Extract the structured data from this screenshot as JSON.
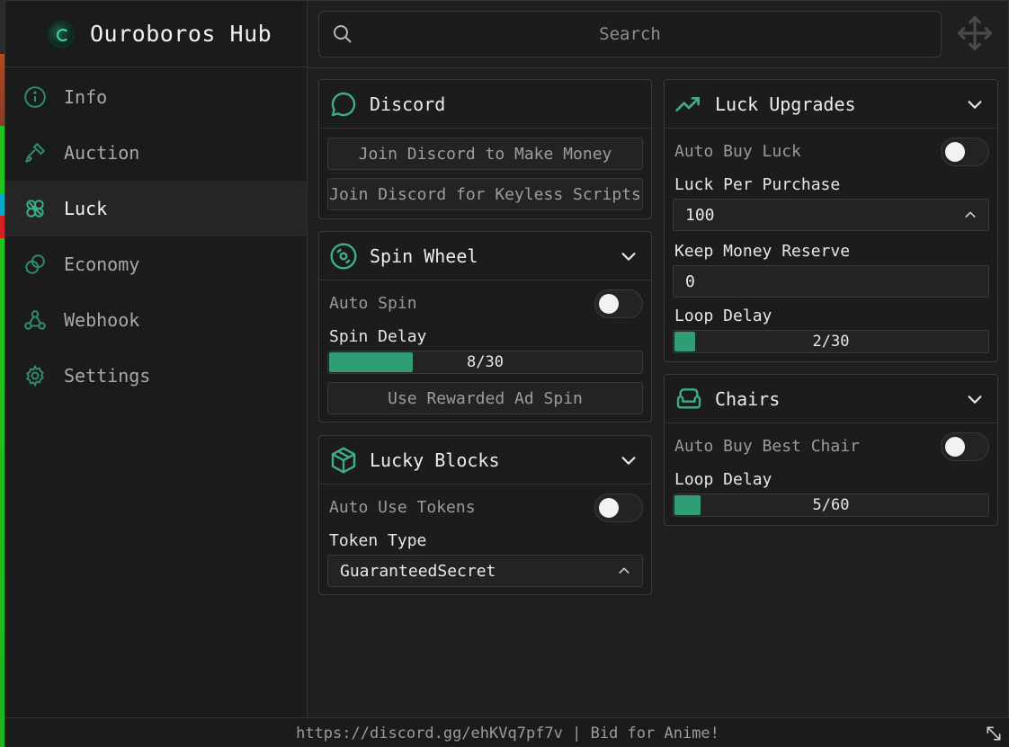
{
  "app": {
    "title": "Ouroboros Hub"
  },
  "search": {
    "placeholder": "Search"
  },
  "sidebar": {
    "items": [
      {
        "label": "Info",
        "icon": "info-icon"
      },
      {
        "label": "Auction",
        "icon": "gavel-icon"
      },
      {
        "label": "Luck",
        "icon": "clover-icon",
        "active": true
      },
      {
        "label": "Economy",
        "icon": "coins-icon"
      },
      {
        "label": "Webhook",
        "icon": "webhook-icon"
      },
      {
        "label": "Settings",
        "icon": "gear-icon"
      }
    ]
  },
  "discord": {
    "title": "Discord",
    "buttons": [
      "Join Discord to Make Money",
      "Join Discord for Keyless Scripts"
    ]
  },
  "spin_wheel": {
    "title": "Spin Wheel",
    "auto_spin_label": "Auto Spin",
    "auto_spin_on": false,
    "delay_label": "Spin Delay",
    "delay_value": "8/30",
    "delay_fraction": 0.267,
    "rewarded_button": "Use Rewarded Ad Spin"
  },
  "lucky_blocks": {
    "title": "Lucky Blocks",
    "auto_use_label": "Auto Use Tokens",
    "auto_use_on": false,
    "token_type_label": "Token Type",
    "token_type_value": "GuaranteedSecret"
  },
  "luck_upgrades": {
    "title": "Luck Upgrades",
    "auto_buy_label": "Auto Buy Luck",
    "auto_buy_on": false,
    "per_purchase_label": "Luck Per Purchase",
    "per_purchase_value": "100",
    "reserve_label": "Keep Money Reserve",
    "reserve_value": "0",
    "loop_delay_label": "Loop Delay",
    "loop_delay_value": "2/30",
    "loop_delay_fraction": 0.067
  },
  "chairs": {
    "title": "Chairs",
    "auto_buy_label": "Auto Buy Best Chair",
    "auto_buy_on": false,
    "loop_delay_label": "Loop Delay",
    "loop_delay_value": "5/60",
    "loop_delay_fraction": 0.083
  },
  "footer": {
    "text": "https://discord.gg/ehKVq7pf7v | Bid for Anime!"
  },
  "colors": {
    "accent": "#2f9e74",
    "icon": "#3fae86",
    "bg": "#1c1c1c"
  }
}
